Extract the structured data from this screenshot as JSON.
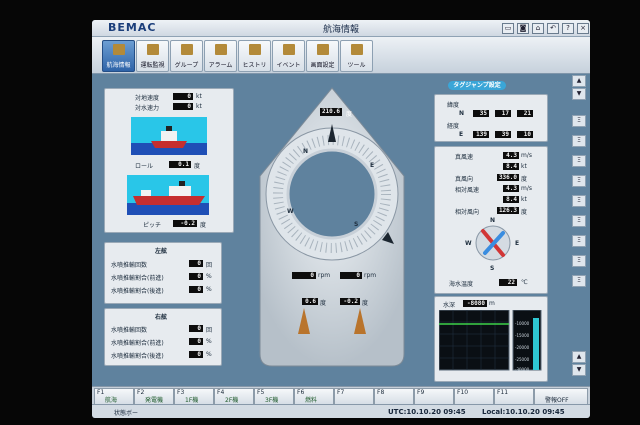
{
  "window": {
    "logo": "BEMAC",
    "title": "航海情報"
  },
  "toolbar": {
    "buttons": [
      {
        "label": "航海情報",
        "active": true
      },
      {
        "label": "運転監視"
      },
      {
        "label": "グループ"
      },
      {
        "label": "アラーム"
      },
      {
        "label": "ヒストリ"
      },
      {
        "label": "イベント"
      },
      {
        "label": "画面設定"
      },
      {
        "label": "ツール"
      }
    ]
  },
  "motion": {
    "roll_speed_label": "対地速度",
    "roll_speed_value": "0",
    "roll_speed_unit": "kt",
    "water_speed_label": "対水速力",
    "water_speed_value": "0",
    "water_speed_unit": "kt",
    "roll_label": "ロール",
    "roll_value": "0.1",
    "roll_unit": "度",
    "pitch_label": "ピッチ",
    "pitch_value": "-0.2",
    "pitch_unit": "度"
  },
  "compass": {
    "heading": "210.6",
    "heading_unit": "度",
    "rpm_port": "0",
    "rpm_stbd": "0",
    "rpm_unit": "rpm",
    "angle_port": "0.6",
    "angle_stbd": "-0.2",
    "angle_unit": "度",
    "marks": [
      "N",
      "E",
      "S",
      "W"
    ]
  },
  "port": {
    "title": "左舷",
    "rows": [
      {
        "label": "水噴推輸回数",
        "value": "0",
        "unit": "回"
      },
      {
        "label": "水噴推輸割合(前進)",
        "value": "0",
        "unit": "%"
      },
      {
        "label": "水噴推輸割合(後進)",
        "value": "0",
        "unit": "%"
      }
    ]
  },
  "stbd": {
    "title": "右舷",
    "rows": [
      {
        "label": "水噴推輸回数",
        "value": "0",
        "unit": "回"
      },
      {
        "label": "水噴推輸割合(前進)",
        "value": "0",
        "unit": "%"
      },
      {
        "label": "水噴推輸割合(後進)",
        "value": "0",
        "unit": "%"
      }
    ]
  },
  "tag_jump_button": "タグジャンプ設定",
  "position": {
    "lat_label": "緯度",
    "lat_dir": "N",
    "lat_deg": "35",
    "lat_min": "17",
    "lat_sec": "21",
    "lon_label": "経度",
    "lon_dir": "E",
    "lon_deg": "139",
    "lon_min": "39",
    "lon_sec": "10"
  },
  "wind": {
    "rows": [
      {
        "label": "真風速",
        "value": "4.3",
        "unit": "m/s"
      },
      {
        "label": "",
        "value": "8.4",
        "unit": "kt"
      },
      {
        "label": "真風向",
        "value": "336.0",
        "unit": "度"
      },
      {
        "label": "相対風速",
        "value": "4.3",
        "unit": "m/s"
      },
      {
        "label": "",
        "value": "8.4",
        "unit": "kt"
      },
      {
        "label": "相対風向",
        "value": "126.3",
        "unit": "度"
      }
    ],
    "sea_temp_label": "海水温度",
    "sea_temp_value": "22",
    "sea_temp_unit": "℃",
    "dial": [
      "N",
      "E",
      "S",
      "W"
    ]
  },
  "depth": {
    "label": "水深",
    "value": "-8080",
    "unit": "m",
    "ticks": [
      "-10000",
      "-15000",
      "-20000",
      "-25000",
      "-30000"
    ]
  },
  "fkeys": [
    {
      "n": "F1",
      "t": "航海"
    },
    {
      "n": "F2",
      "t": "発電機"
    },
    {
      "n": "F3",
      "t": "1F機"
    },
    {
      "n": "F4",
      "t": "2F機"
    },
    {
      "n": "F5",
      "t": "3F機"
    },
    {
      "n": "F6",
      "t": "燃料"
    },
    {
      "n": "F7",
      "t": ""
    },
    {
      "n": "F8",
      "t": ""
    },
    {
      "n": "F9",
      "t": ""
    },
    {
      "n": "F10",
      "t": ""
    },
    {
      "n": "F11",
      "t": ""
    },
    {
      "n": "",
      "t": "警報OFF"
    }
  ],
  "status": {
    "left": "状態ボー",
    "utc": "UTC:10.10.20 09:45",
    "local": "Local:10.10.20 09:45"
  },
  "sidebar": [
    "▲",
    "▼",
    "Ξ",
    "Ξ",
    "Ξ",
    "Ξ",
    "Ξ",
    "Ξ",
    "Ξ",
    "Ξ",
    "Ξ",
    "▲",
    "▼"
  ]
}
